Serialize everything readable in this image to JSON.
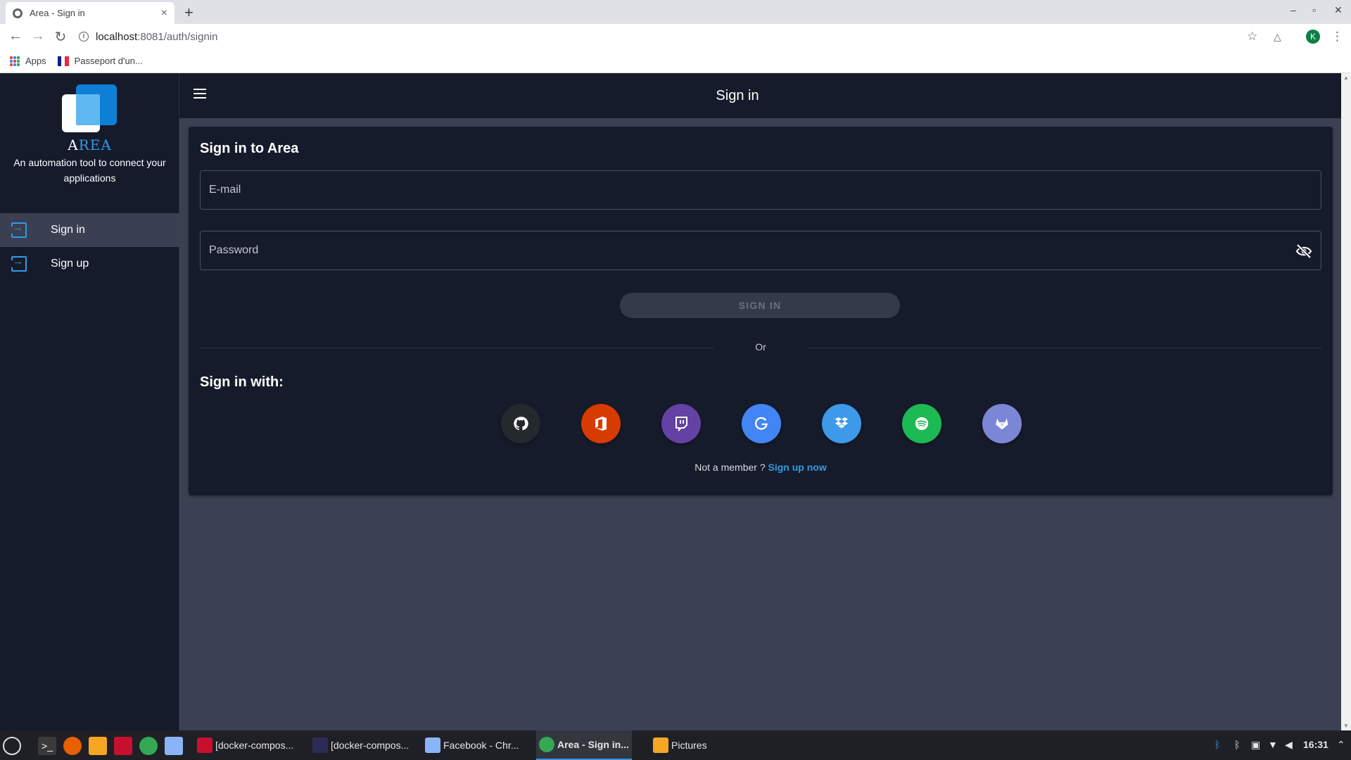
{
  "browser": {
    "tab_title": "Area - Sign in",
    "tab_close": "×",
    "new_tab": "+",
    "url_host": "localhost",
    "url_rest": ":8081/auth/signin",
    "profile_initial": "K",
    "window_controls": {
      "minimize": "–",
      "maximize": "▫",
      "close": "✕"
    },
    "nav": {
      "back": "←",
      "forward": "→",
      "reload": "↻"
    },
    "bookmarks": [
      {
        "label": "Apps"
      },
      {
        "label": "Passeport d'un..."
      }
    ]
  },
  "sidebar": {
    "brand_first": "A",
    "brand_rest": "REA",
    "tagline": "An automation tool to connect your applications",
    "items": [
      {
        "label": "Sign in",
        "icon": "login-icon",
        "active": true
      },
      {
        "label": "Sign up",
        "icon": "login-icon",
        "active": false
      }
    ]
  },
  "appbar": {
    "title": "Sign in"
  },
  "form": {
    "title": "Sign in to Area",
    "email_placeholder": "E-mail",
    "email_value": "",
    "password_placeholder": "Password",
    "password_value": "",
    "submit_label": "SIGN IN",
    "or_label": "Or",
    "with_title": "Sign in with:",
    "providers": [
      {
        "name": "github",
        "color": "#24292e"
      },
      {
        "name": "office",
        "color": "#d83b01"
      },
      {
        "name": "twitch",
        "color": "#6441a5"
      },
      {
        "name": "google",
        "color": "#4285f4"
      },
      {
        "name": "dropbox",
        "color": "#3d9ae8"
      },
      {
        "name": "spotify",
        "color": "#1db954"
      },
      {
        "name": "gitlab",
        "color": "#7b86d6"
      }
    ],
    "member_text": "Not a member ?",
    "signup_link": "Sign up now"
  },
  "colors": {
    "accent": "#2f9be5",
    "sidebar_bg": "#161b2b",
    "content_bg": "#3b4152"
  },
  "taskbar": {
    "tasks": [
      {
        "label": "[docker-compos..."
      },
      {
        "label": "[docker-compos..."
      },
      {
        "label": "Facebook - Chr..."
      },
      {
        "label": "Area - Sign in...",
        "active": true
      },
      {
        "label": "Pictures"
      }
    ],
    "clock": "16:31"
  }
}
